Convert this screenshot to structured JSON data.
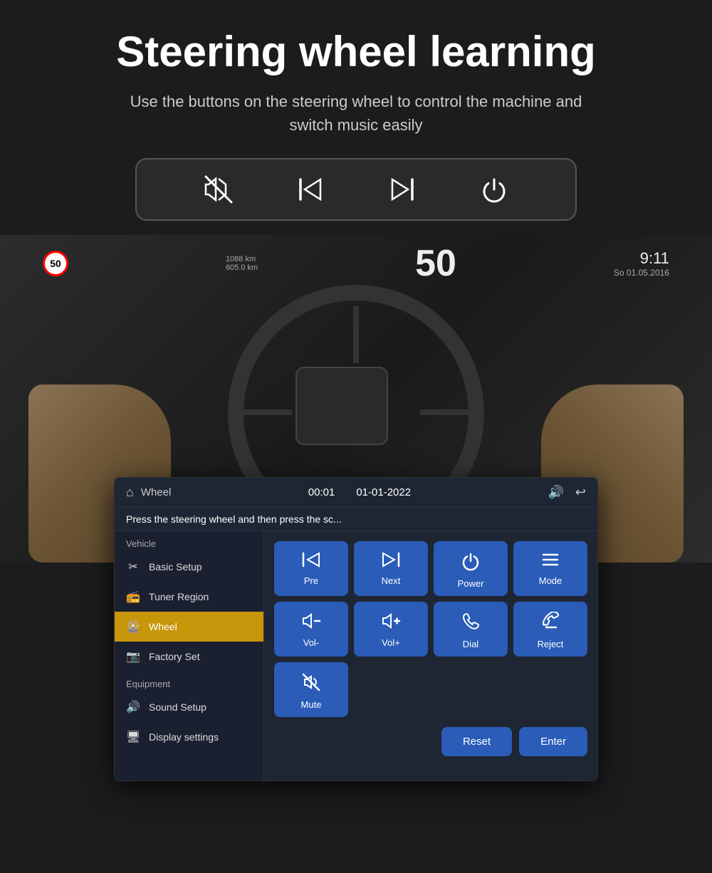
{
  "page": {
    "title": "Steering wheel learning",
    "subtitle": "Use the buttons on the steering wheel to control the machine and switch music easily"
  },
  "iconBar": {
    "icons": [
      "mute-off",
      "prev-track",
      "next-track",
      "power"
    ]
  },
  "panel": {
    "header": {
      "icon": "home",
      "label": "Wheel",
      "time": "00:01",
      "date": "01-01-2022",
      "volume_icon": "volume",
      "back_icon": "back"
    },
    "instruction": "Press the steering wheel and then press the sc...",
    "sidebar": {
      "groups": [
        {
          "label": "Vehicle",
          "items": [
            {
              "icon": "wrench",
              "label": "Basic Setup",
              "active": false
            },
            {
              "icon": "radio",
              "label": "Tuner Region",
              "active": false
            },
            {
              "icon": "wheel",
              "label": "Wheel",
              "active": true
            },
            {
              "icon": "factory",
              "label": "Factory Set",
              "active": false
            }
          ]
        },
        {
          "label": "Equipment",
          "items": [
            {
              "icon": "sound",
              "label": "Sound Setup",
              "active": false
            },
            {
              "icon": "display",
              "label": "Display settings",
              "active": false
            }
          ]
        }
      ]
    },
    "controls": {
      "row1": [
        {
          "icon": "prev",
          "label": "Pre"
        },
        {
          "icon": "next",
          "label": "Next"
        },
        {
          "icon": "power",
          "label": "Power"
        },
        {
          "icon": "mode",
          "label": "Mode"
        }
      ],
      "row2": [
        {
          "icon": "vol-down",
          "label": "Vol-"
        },
        {
          "icon": "vol-up",
          "label": "Vol+"
        },
        {
          "icon": "dial",
          "label": "Dial"
        },
        {
          "icon": "reject",
          "label": "Reject"
        }
      ],
      "row3": [
        {
          "icon": "mute",
          "label": "Mute"
        }
      ]
    },
    "buttons": {
      "reset": "Reset",
      "enter": "Enter"
    }
  }
}
